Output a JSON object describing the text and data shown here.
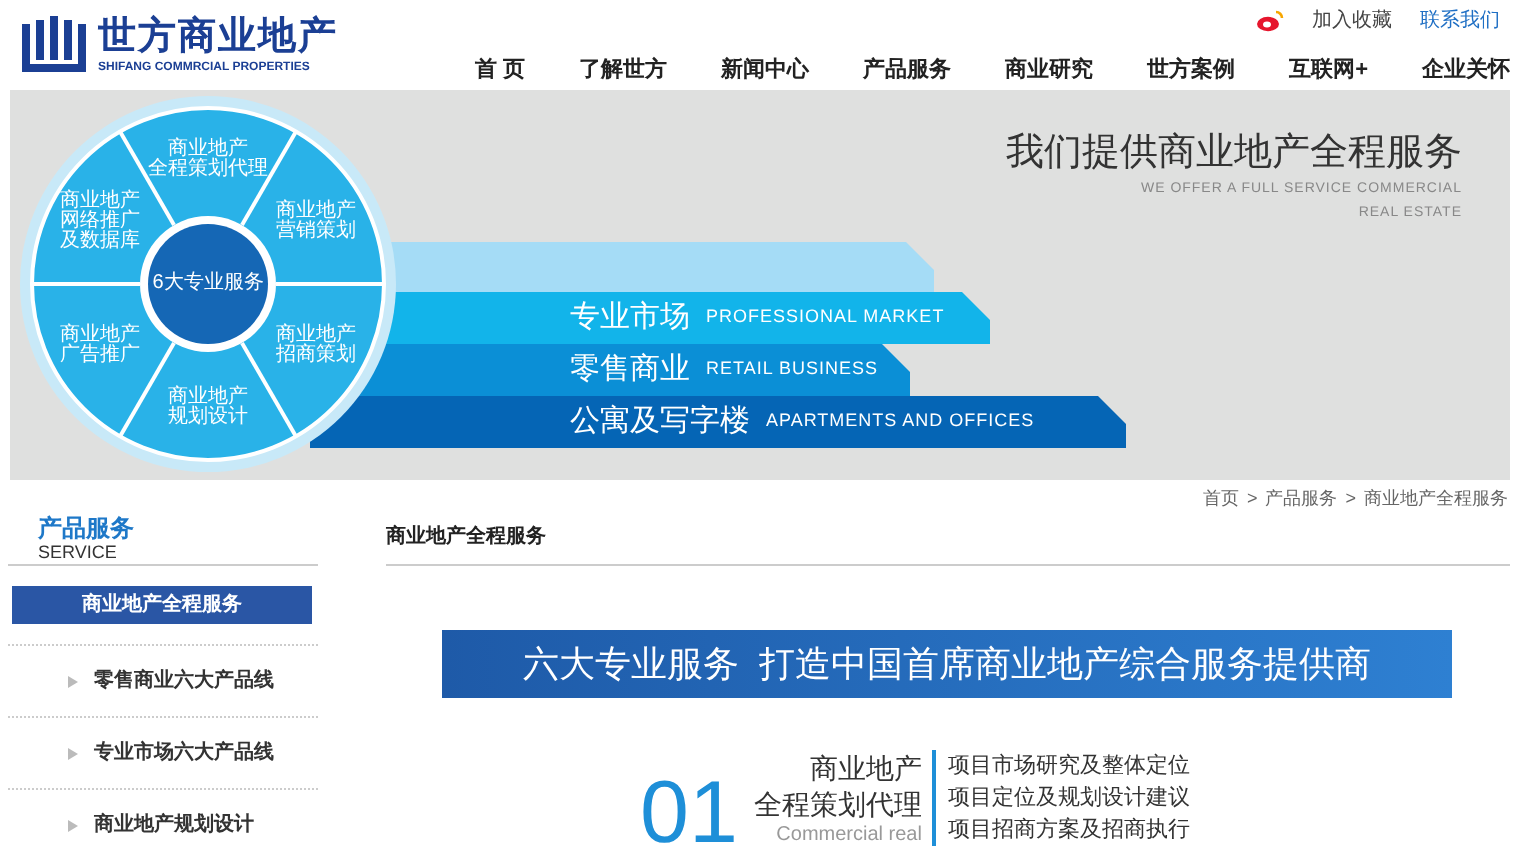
{
  "header": {
    "logo_title": "世方商业地产",
    "logo_subtitle": "SHIFANG COMMRCIAL PROPERTIES",
    "top_links": [
      {
        "label": "加入收藏",
        "highlighted": false
      },
      {
        "label": "联系我们",
        "highlighted": true
      }
    ],
    "nav": [
      "首 页",
      "了解世方",
      "新闻中心",
      "产品服务",
      "商业研究",
      "世方案例",
      "互联网+",
      "企业关怀"
    ]
  },
  "banner": {
    "heading": "我们提供商业地产全程服务",
    "subheading_lines": [
      "WE OFFER A FULL SERVICE COMMERCIAL",
      "REAL ESTATE"
    ],
    "wheel": {
      "center": "6大专业服务",
      "segments": [
        {
          "lines": [
            "商业地产",
            "全程策划代理"
          ]
        },
        {
          "lines": [
            "商业地产",
            "网络推广",
            "及数据库"
          ]
        },
        {
          "lines": [
            "商业地产",
            "营销策划"
          ]
        },
        {
          "lines": [
            "商业地产",
            "广告推广"
          ]
        },
        {
          "lines": [
            "商业地产",
            "招商策划"
          ]
        },
        {
          "lines": [
            "商业地产",
            "规划设计"
          ]
        }
      ]
    },
    "stripes": [
      {
        "cn": "专业市场",
        "en": "PROFESSIONAL MARKET"
      },
      {
        "cn": "零售商业",
        "en": "RETAIL BUSINESS"
      },
      {
        "cn": "公寓及写字楼",
        "en": "APARTMENTS AND OFFICES"
      }
    ]
  },
  "breadcrumb": {
    "items": [
      "首页",
      "产品服务",
      "商业地产全程服务"
    ],
    "separator": ">"
  },
  "sidebar": {
    "title": "产品服务",
    "subtitle": "SERVICE",
    "items": [
      {
        "label": "商业地产全程服务",
        "selected": true
      },
      {
        "label": "零售商业六大产品线",
        "selected": false
      },
      {
        "label": "专业市场六大产品线",
        "selected": false
      },
      {
        "label": "商业地产规划设计",
        "selected": false
      }
    ]
  },
  "content": {
    "title": "商业地产全程服务",
    "slogan": "六大专业服务  打造中国首席商业地产综合服务提供商",
    "services": [
      {
        "number": "01",
        "title_lines": [
          "商业地产",
          "全程策划代理"
        ],
        "en": "Commercial real",
        "points": [
          "项目市场研究及整体定位",
          "项目定位及规划设计建议",
          "项目招商方案及招商执行"
        ]
      }
    ]
  }
}
